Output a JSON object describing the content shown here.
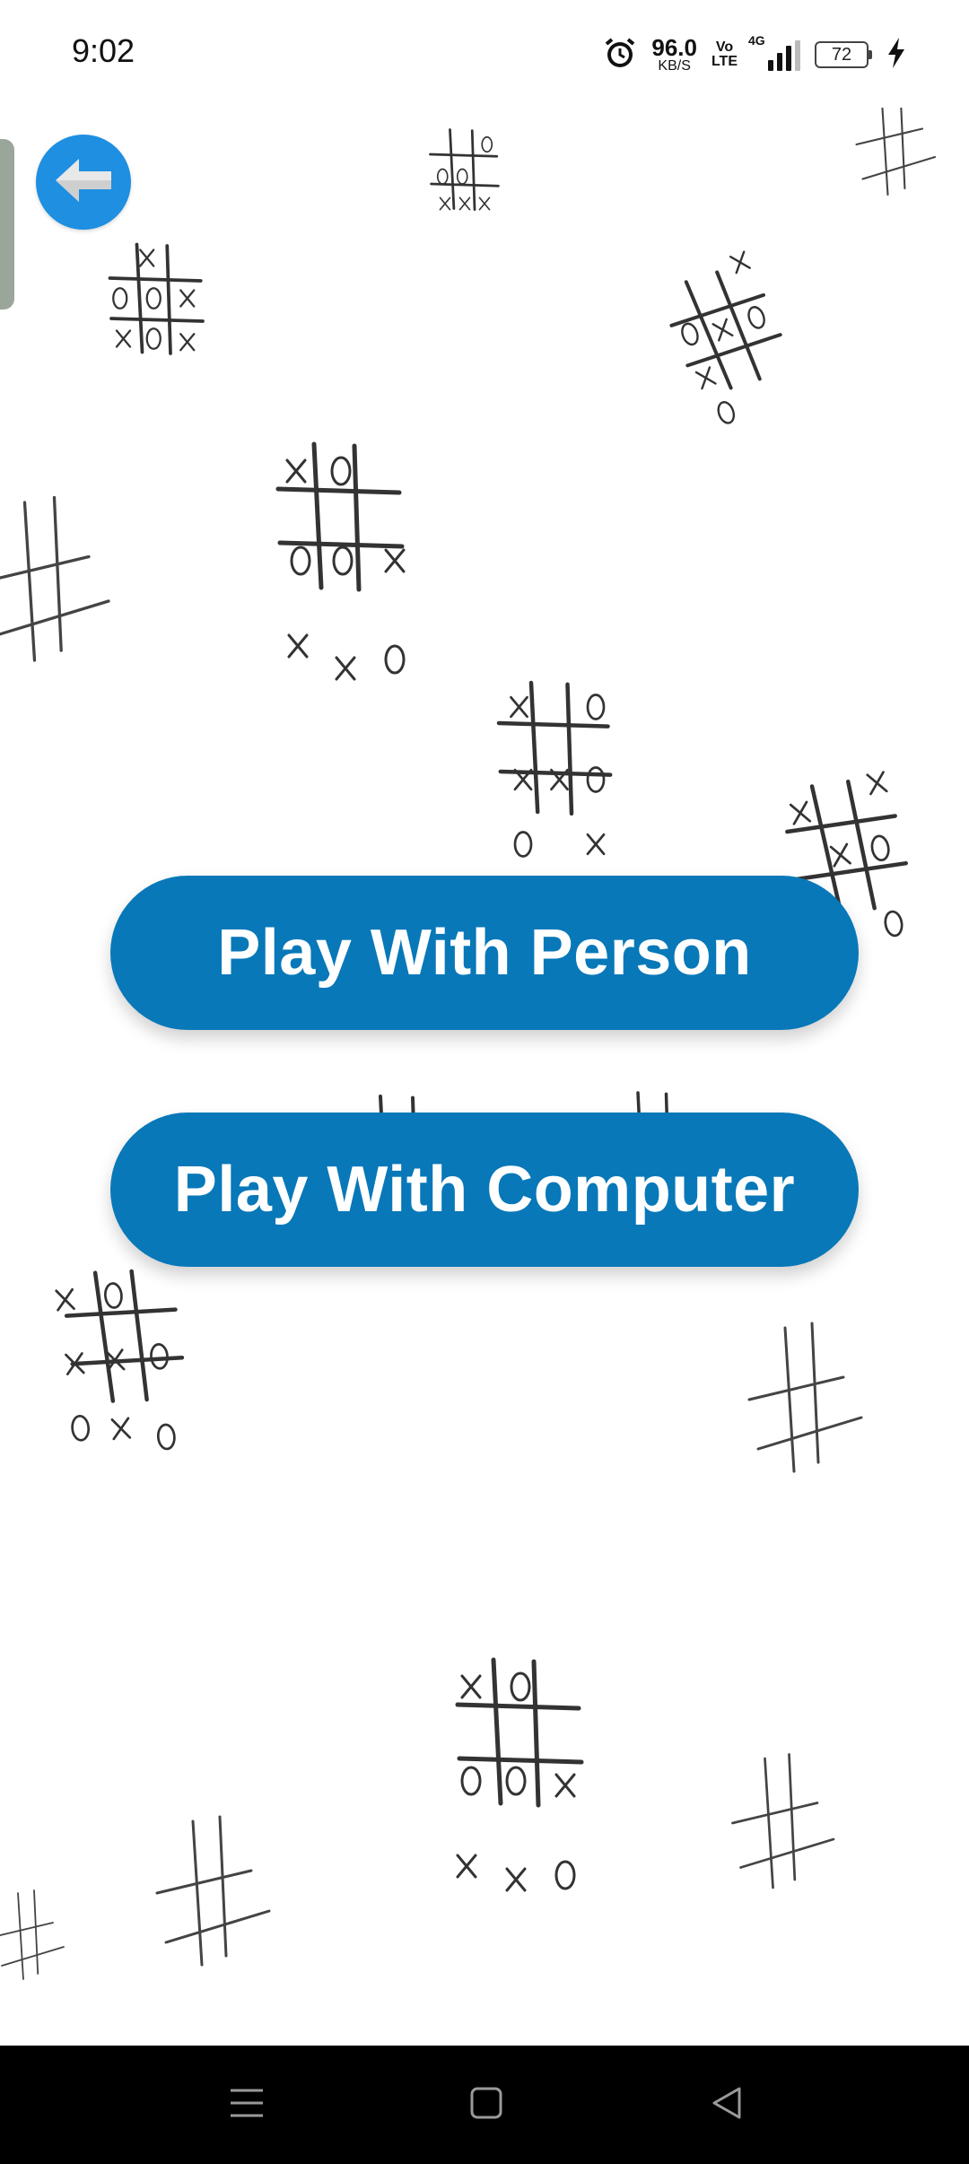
{
  "status_bar": {
    "time": "9:02",
    "net_speed_value": "96.0",
    "net_speed_unit": "KB/S",
    "volte_top": "Vo",
    "volte_bottom": "LTE",
    "network_type": "4G",
    "battery_level": "72",
    "icons": [
      "alarm-icon",
      "signal-icon",
      "battery-icon",
      "charging-icon"
    ]
  },
  "back_button": {
    "icon": "arrow-left-icon",
    "color": "#1e8fe1"
  },
  "menu": {
    "play_person_label": "Play With Person",
    "play_computer_label": "Play With Computer",
    "button_color": "#0878b8"
  },
  "background": {
    "pattern": "hand-drawn tic-tac-toe doodles"
  },
  "nav_bar": {
    "icons": [
      "menu-icon",
      "home-icon",
      "back-triangle-icon"
    ]
  }
}
